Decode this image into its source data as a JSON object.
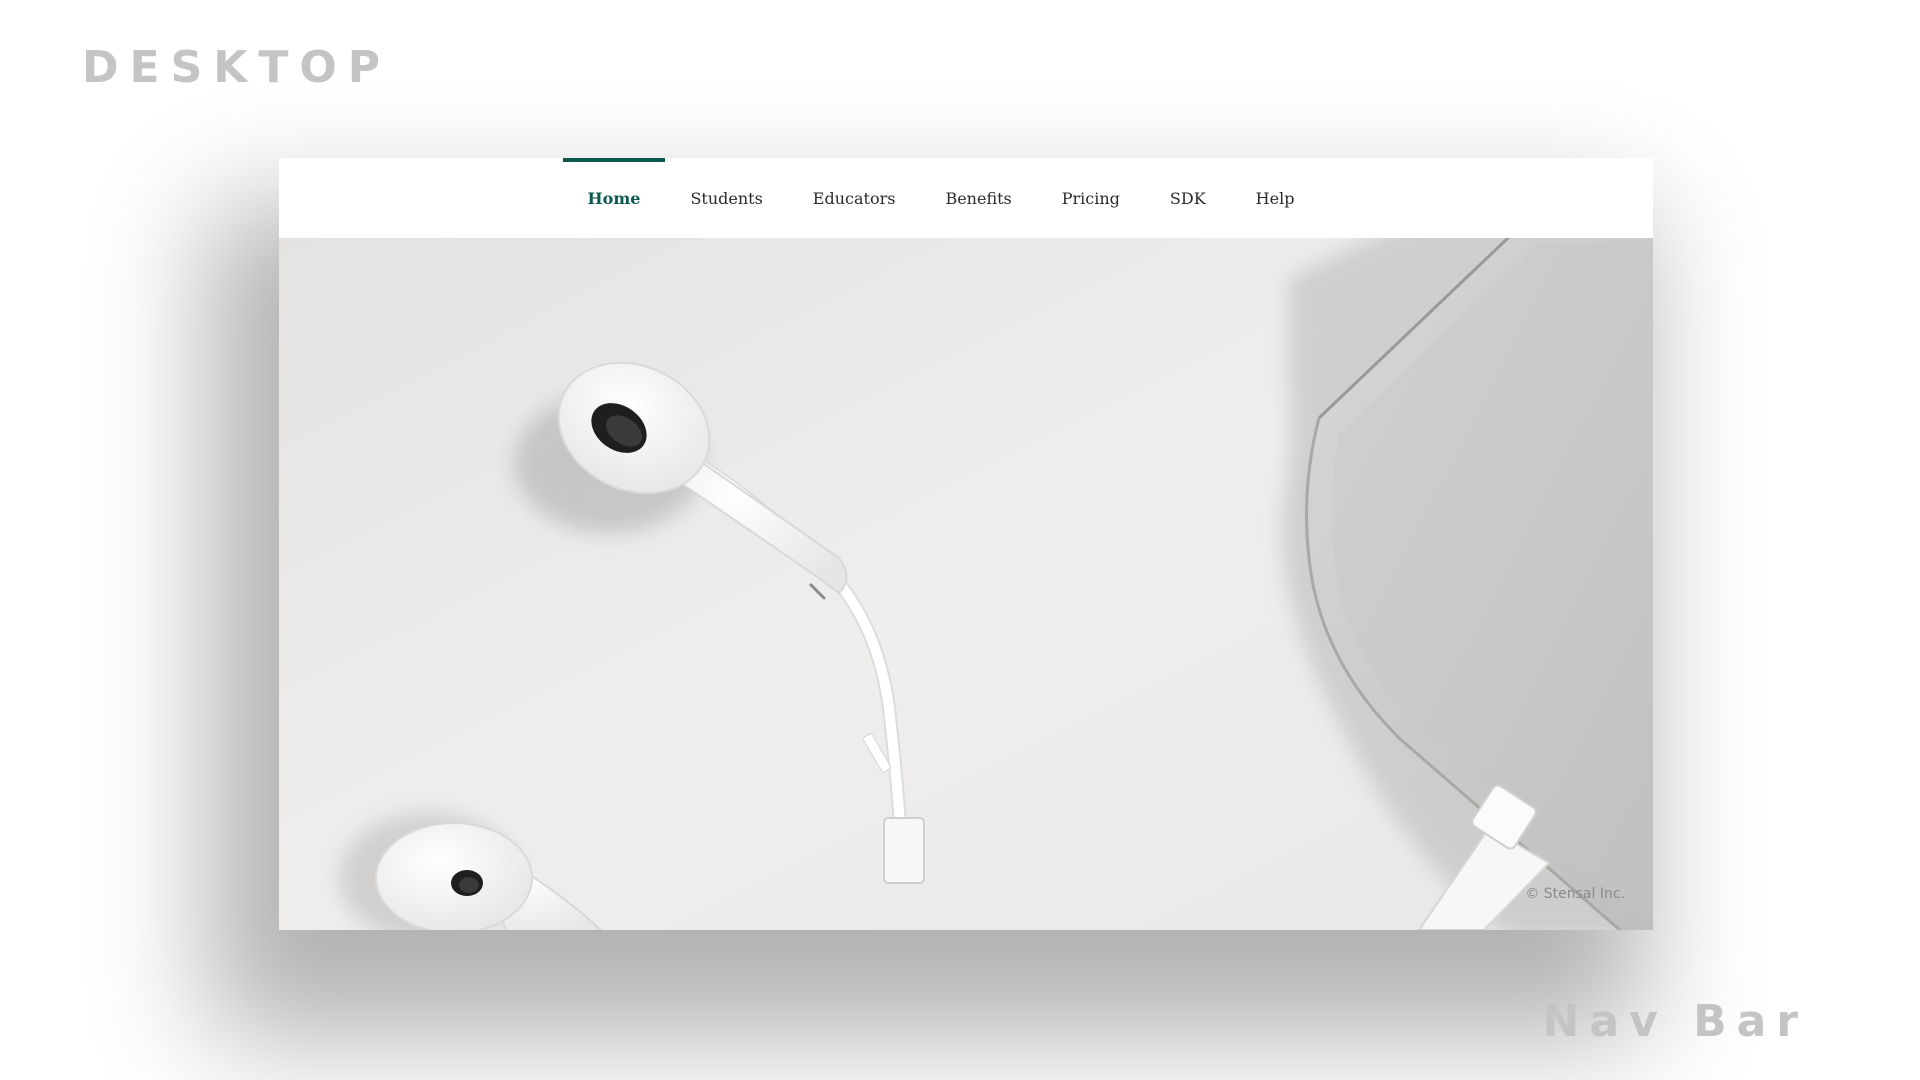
{
  "labels": {
    "device": "DESKTOP",
    "component": "Nav Bar"
  },
  "nav": {
    "items": [
      {
        "label": "Home",
        "active": true
      },
      {
        "label": "Students",
        "active": false
      },
      {
        "label": "Educators",
        "active": false
      },
      {
        "label": "Benefits",
        "active": false
      },
      {
        "label": "Pricing",
        "active": false
      },
      {
        "label": "SDK",
        "active": false
      },
      {
        "label": "Help",
        "active": false
      }
    ],
    "accent_color": "#0c5a4d"
  },
  "hero": {
    "image": "white-earphones-and-smartphone-photo",
    "copyright": "© Stensal Inc."
  }
}
